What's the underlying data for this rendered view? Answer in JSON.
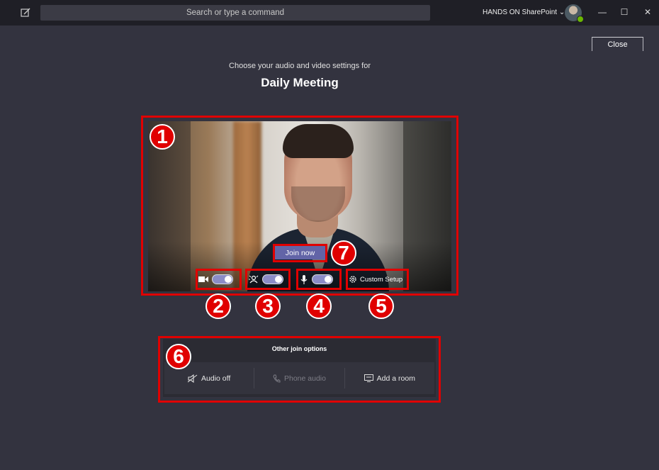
{
  "titlebar": {
    "search_placeholder": "Search or type a command",
    "org_name": "HANDS ON SharePoint",
    "org_chevron": "⌄",
    "minimize": "—",
    "maximize": "☐",
    "close": "✕"
  },
  "header": {
    "close_label": "Close",
    "subtitle": "Choose your audio and video settings for",
    "meeting_title": "Daily Meeting"
  },
  "preview": {
    "join_label": "Join now",
    "custom_setup_label": "Custom Setup",
    "camera_on": true,
    "blur_on": true,
    "mic_on": true
  },
  "join_options": {
    "title": "Other join options",
    "items": [
      {
        "label": "Audio off",
        "icon": "speaker-off-icon",
        "enabled": true
      },
      {
        "label": "Phone audio",
        "icon": "phone-icon",
        "enabled": false
      },
      {
        "label": "Add a room",
        "icon": "room-icon",
        "enabled": true
      }
    ]
  },
  "annotations": {
    "n1": "1",
    "n2": "2",
    "n3": "3",
    "n4": "4",
    "n5": "5",
    "n6": "6",
    "n7": "7",
    "color": "#e00000"
  },
  "colors": {
    "accent": "#6264a7",
    "background": "#33333f",
    "titlebar": "#1f1f26"
  }
}
